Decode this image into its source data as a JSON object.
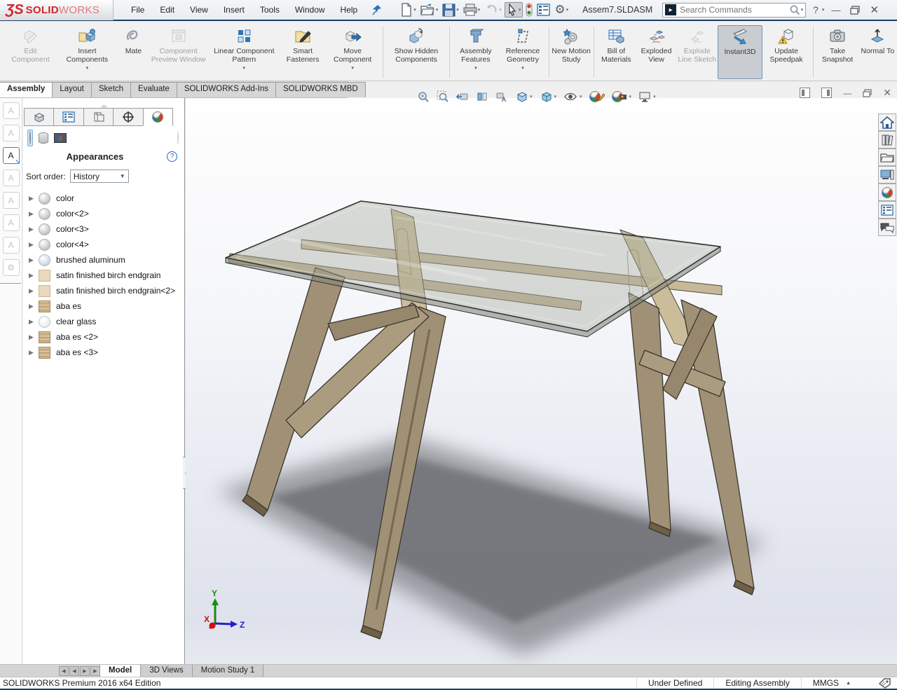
{
  "titlebar": {
    "logo_ds": "ƷS",
    "logo_solid": "SOLID",
    "logo_works": "WORKS",
    "menus": [
      "File",
      "Edit",
      "View",
      "Insert",
      "Tools",
      "Window",
      "Help"
    ],
    "document_title": "Assem7.SLDASM",
    "search_placeholder": "Search Commands",
    "help_label": "?",
    "toolbar_icons": [
      "new-document-icon",
      "open-icon",
      "save-icon",
      "print-icon",
      "undo-icon",
      "select-cursor-icon",
      "traffic-light-icon",
      "property-manager-icon",
      "options-gear-icon"
    ],
    "window_icons": [
      "minimize-icon",
      "restore-icon",
      "close-icon"
    ]
  },
  "ribbon": {
    "buttons": [
      {
        "label": "Edit Component",
        "enabled": false,
        "dropdown": false
      },
      {
        "label": "Insert Components",
        "enabled": true,
        "dropdown": true
      },
      {
        "label": "Mate",
        "enabled": true,
        "dropdown": false
      },
      {
        "label": "Component Preview Window",
        "enabled": false,
        "dropdown": false
      },
      {
        "label": "Linear Component Pattern",
        "enabled": true,
        "dropdown": true
      },
      {
        "label": "Smart Fasteners",
        "enabled": true,
        "dropdown": false
      },
      {
        "label": "Move Component",
        "enabled": true,
        "dropdown": true
      },
      {
        "label": "Show Hidden Components",
        "enabled": true,
        "dropdown": false
      },
      {
        "label": "Assembly Features",
        "enabled": true,
        "dropdown": true
      },
      {
        "label": "Reference Geometry",
        "enabled": true,
        "dropdown": true
      },
      {
        "label": "New Motion Study",
        "enabled": true,
        "dropdown": false
      },
      {
        "label": "Bill of Materials",
        "enabled": true,
        "dropdown": false
      },
      {
        "label": "Exploded View",
        "enabled": true,
        "dropdown": false
      },
      {
        "label": "Explode Line Sketch",
        "enabled": false,
        "dropdown": false
      },
      {
        "label": "Instant3D",
        "enabled": true,
        "dropdown": false,
        "active": true
      },
      {
        "label": "Update Speedpak",
        "enabled": true,
        "dropdown": false
      },
      {
        "label": "Take Snapshot",
        "enabled": true,
        "dropdown": false
      },
      {
        "label": "Normal To",
        "enabled": true,
        "dropdown": false
      }
    ],
    "tabs": [
      "Assembly",
      "Layout",
      "Sketch",
      "Evaluate",
      "SOLIDWORKS Add-Ins",
      "SOLIDWORKS MBD"
    ],
    "active_tab": "Assembly"
  },
  "headsup_icons": [
    "zoom-to-fit-icon",
    "zoom-to-area-icon",
    "previous-view-icon",
    "section-view-icon",
    "annotation-view-icon",
    "view-orientation-icon",
    "display-style-icon",
    "hide-show-items-icon",
    "edit-appearance-icon",
    "apply-scene-icon",
    "view-settings-icon"
  ],
  "left_toolbar_icons": [
    "note-star-icon",
    "note-edit-icon",
    "note-active-icon",
    "note-gear-icon",
    "note-balloon-icon",
    "note-copy-icon",
    "stamp-icon",
    "chain-icon"
  ],
  "panel": {
    "tabs_icons": [
      "features-tree-icon",
      "property-tab-icon",
      "configurations-icon",
      "dimxpert-icon",
      "appearances-tab-icon"
    ],
    "active_tab": "appearances-tab-icon",
    "sub_icons": [
      "appearance-ball-icon",
      "material-icon",
      "scene-icon",
      "decal-gear-icon"
    ],
    "title": "Appearances",
    "help": "?",
    "sort_label": "Sort order:",
    "sort_value": "History",
    "items": [
      {
        "label": "color",
        "icon": "sphere-gray"
      },
      {
        "label": "color<2>",
        "icon": "sphere-gray"
      },
      {
        "label": "color<3>",
        "icon": "sphere-gray"
      },
      {
        "label": "color<4>",
        "icon": "sphere-gray"
      },
      {
        "label": "brushed aluminum",
        "icon": "sphere-aluminum"
      },
      {
        "label": "satin finished birch endgrain",
        "icon": "swatch-birch"
      },
      {
        "label": "satin finished birch endgrain<2>",
        "icon": "swatch-birch"
      },
      {
        "label": "aba es",
        "icon": "swatch-wood"
      },
      {
        "label": "clear glass",
        "icon": "sphere-glass"
      },
      {
        "label": "aba es <2>",
        "icon": "swatch-wood"
      },
      {
        "label": "aba es <3>",
        "icon": "swatch-wood"
      }
    ]
  },
  "taskpane_icons": [
    "home-icon",
    "design-library-icon",
    "file-explorer-icon",
    "view-palette-icon",
    "appearances-scenes-icon",
    "custom-properties-icon",
    "forum-icon"
  ],
  "viewport": {
    "triad": {
      "x": "X",
      "y": "Y",
      "z": "Z"
    },
    "model": "glass-top plywood table assembly"
  },
  "bottom": {
    "tabs": [
      {
        "label": "Model",
        "active": true
      },
      {
        "label": "3D Views",
        "active": false
      },
      {
        "label": "Motion Study 1",
        "active": false
      }
    ]
  },
  "statusbar": {
    "product": "SOLIDWORKS Premium 2016 x64 Edition",
    "constraint_status": "Under Defined",
    "mode": "Editing Assembly",
    "units": "MMGS"
  },
  "colors": {
    "accent_navy": "#1d3e63",
    "sw_red": "#d1262c",
    "wood": "#a09176",
    "glass": "#a8ab9f",
    "instant3d_selected_bg": "#c9cdd1"
  }
}
